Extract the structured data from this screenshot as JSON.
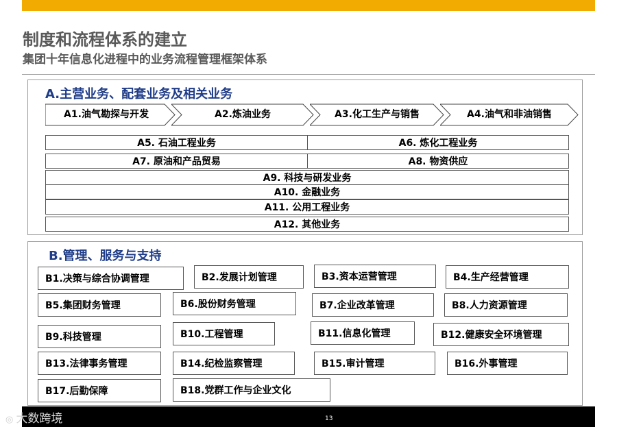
{
  "header": {
    "title": "制度和流程体系的建立",
    "subtitle": "集团十年信息化进程中的业务流程管理框架体系"
  },
  "sectionA": {
    "heading": "A.主营业务、配套业务及相关业务",
    "chevrons": [
      "A1.油气勘探与开发",
      "A2.炼油业务",
      "A3.化工生产与销售",
      "A4.油气和非油销售"
    ],
    "pairs": [
      [
        "A5. 石油工程业务",
        "A6. 炼化工程业务"
      ],
      [
        "A7. 原油和产品贸易",
        "A8. 物资供应"
      ]
    ],
    "full_bars": [
      "A9. 科技与研发业务",
      "A10. 金融业务",
      "A11. 公用工程业务",
      "A12. 其他业务"
    ]
  },
  "sectionB": {
    "heading": "B.管理、服务与支持",
    "items": [
      "B1.决策与综合协调管理",
      "B2.发展计划管理",
      "B3.资本运营管理",
      "B4.生产经营管理",
      "B5.集团财务管理",
      "B6.股份财务管理",
      "B7.企业改革管理",
      "B8.人力资源管理",
      "B9.科技管理",
      "B10.工程管理",
      "B11.信息化管理",
      "B12.健康安全环境管理",
      "B13.法律事务管理",
      "B14.纪检监察管理",
      "B15.审计管理",
      "B16.外事管理",
      "B17.后勤保障",
      "B18.党群工作与企业文化"
    ]
  },
  "footer": {
    "page_number": "13",
    "watermark": "大数跨境"
  },
  "colors": {
    "accent_bar": "#f2ab00",
    "heading_blue": "#1f3c88",
    "title_gray": "#595959",
    "footer_bg": "#000000"
  }
}
